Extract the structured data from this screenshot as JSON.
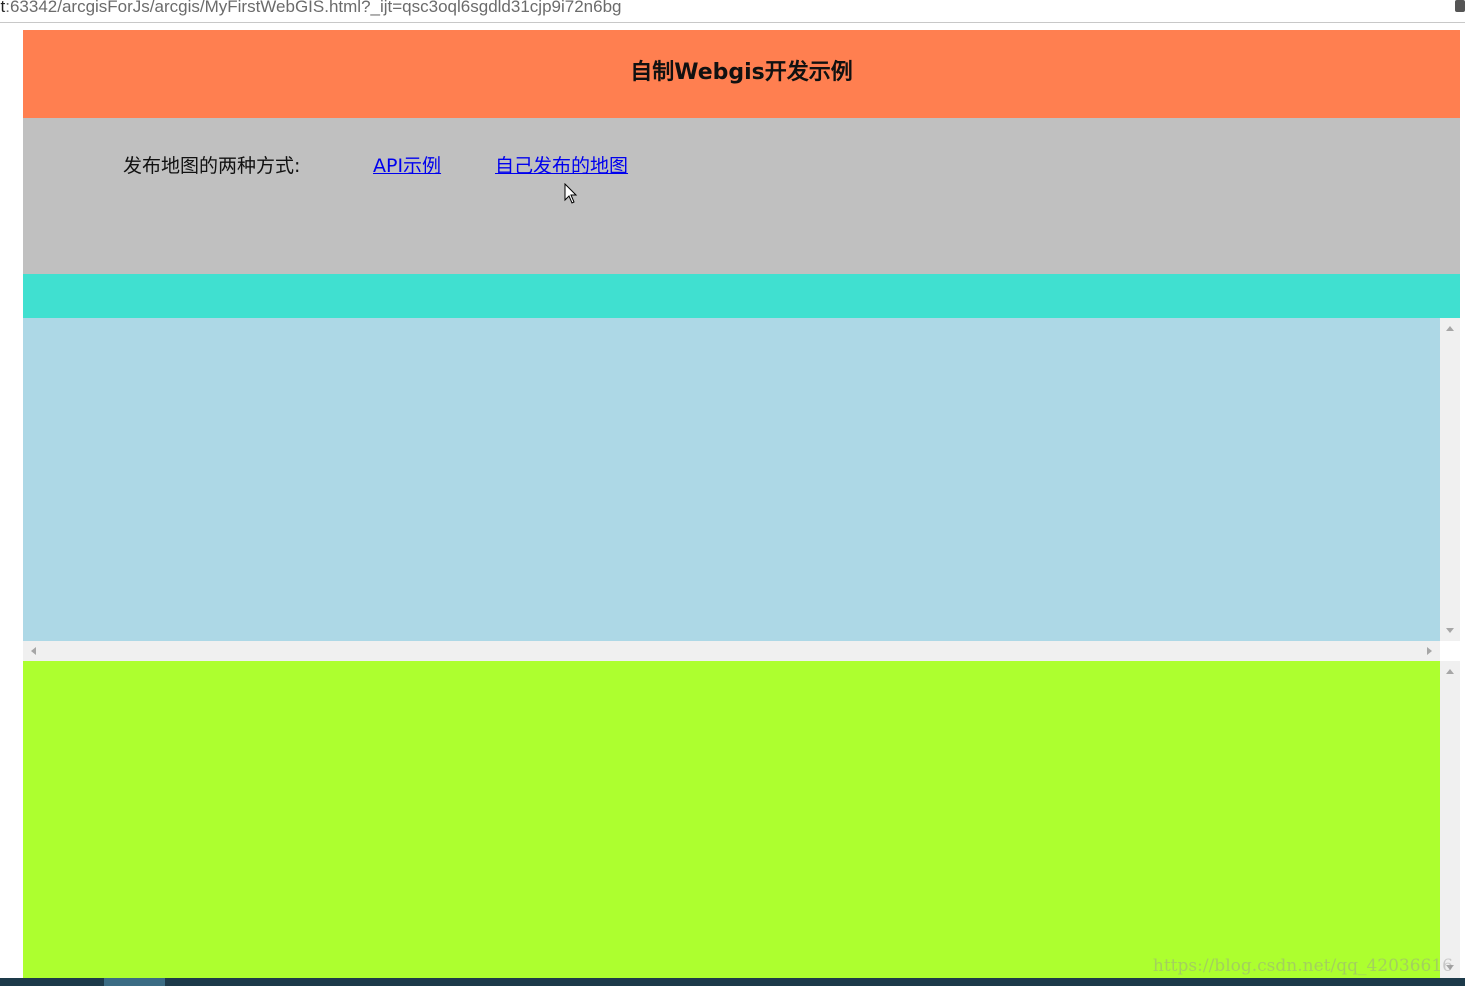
{
  "browser": {
    "url_host": "st",
    "url_rest": ":63342/arcgisForJs/arcgis/MyFirstWebGIS.html?_ijt=qsc3oql6sgdld31cjp9i72n6bg"
  },
  "header": {
    "title": "自制Webgis开发示例"
  },
  "nav": {
    "lead_text": "发布地图的两种方式:",
    "links": [
      {
        "label": "API示例"
      },
      {
        "label": "自己发布的地图"
      }
    ]
  },
  "watermark": {
    "text": "https://blog.csdn.net/qq_42036616"
  },
  "colors": {
    "header_bg": "#ff7f50",
    "nav_bg": "#c0c0c0",
    "strip_bg": "#40e0d0",
    "map1_bg": "#add8e6",
    "map2_bg": "#adff2f",
    "link": "#0000ee"
  }
}
